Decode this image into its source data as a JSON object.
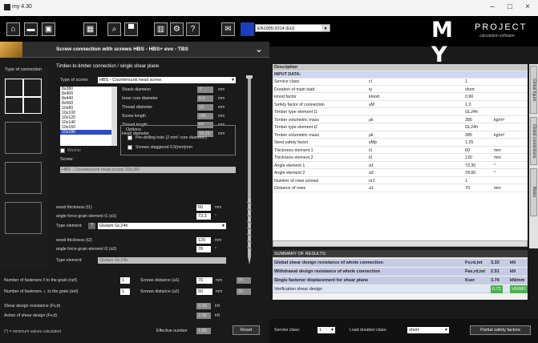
{
  "window": {
    "title": "my 4.30",
    "minimize": "–",
    "maximize": "□",
    "close": "×"
  },
  "toolbar": {
    "standard": "EN1995:2014 (EU)",
    "info": "?"
  },
  "logo": {
    "big": "M Y",
    "brand": "PROJECT",
    "tagline": "calculation software"
  },
  "header": {
    "title": "Screw connection with screws HBS - HBS+ evo - TBS",
    "chevron": "⌄"
  },
  "left": {
    "type_label": "Type of connection"
  },
  "form": {
    "section_title": "Timber-to-timber connection / single shear plane",
    "type_of_screw_label": "Type of screw:",
    "type_of_screw": "HBS - Countersunk head screw",
    "screw_list": [
      "8x380",
      "8x400",
      "8x440",
      "8x500",
      "10x80",
      "10x100",
      "10x120",
      "10x140",
      "10x160",
      "10x180"
    ],
    "screw_selected_index": 9,
    "props": [
      {
        "label": "Shank diameter",
        "value": "7",
        "unit": "mm"
      },
      {
        "label": "Inner core diameter",
        "value": "6.4",
        "unit": "mm"
      },
      {
        "label": "Thread diameter",
        "value": "10",
        "unit": "mm"
      },
      {
        "label": "Screw length",
        "value": "180",
        "unit": "mm"
      },
      {
        "label": "Thread length",
        "value": "60",
        "unit": "mm"
      },
      {
        "label": "Head diameter",
        "value": "18.25",
        "unit": "mm"
      }
    ],
    "options_label": "Options",
    "opt1": "Pre-drilling hole (2 mm² core diameter)",
    "opt2": "Screws staggered 0.5(mm)mm",
    "washer_label": "Washer",
    "screw_label": "Screw:",
    "screw_desc": "HBS - Countersunk head screw 10x180",
    "thickness1_label": "wood thickness (t1)",
    "thickness1": "60",
    "angle1_label": "angle force-grain element t1 (α1)",
    "angle1": "73.3",
    "type_el1_label": "Type element:",
    "type_el1": "Glulam GL24h",
    "thickness2_label": "wood thickness (t2)",
    "thickness2": "120",
    "angle2_label": "angle force-grain element t2 (α2)",
    "angle2": "78",
    "type_el2_label": "Type element:",
    "type_el2": "Glulam GL24h",
    "fast_par_label": "Number of fasteners // to the grain (nef)",
    "fast_par": "1",
    "fast_perp_label": "Number of fasteners ⊥ to the grain (nef)",
    "fast_perp": "1",
    "dist1_label": "Screws distance (a1)",
    "dist1": "70",
    "dist1_min": "70",
    "dist2_label": "Screws distance (a2)",
    "dist2": "50",
    "dist2_min": "50",
    "shear_res_label": "Shear design resistance (Fv,d)",
    "shear_res": "3.33",
    "axial_res_label": "Action of shear design (Fv,d)",
    "axial_res": "2.39",
    "unit_kn": "kN",
    "unit_mm": "mm",
    "unit_deg": "°",
    "note": "(*) = minimum values calculated",
    "effective_label": "Effective number",
    "effective": "1.00",
    "reset": "Reset"
  },
  "table": {
    "headers": [
      "Description",
      "",
      ""
    ],
    "section": "INPUT DATA:",
    "rows": [
      [
        "Service class",
        "cl",
        "1",
        ""
      ],
      [
        "Duration of main load",
        "ty",
        "short",
        ""
      ],
      [
        "kmod factor",
        "kmod",
        "0.90",
        ""
      ],
      [
        "Safety factor of connection",
        "γM",
        "1.3",
        ""
      ],
      [
        "Timber type element t1",
        "",
        "GL24h",
        ""
      ],
      [
        "Timber volumetric mass",
        "ρk",
        "385",
        "kg/m³"
      ],
      [
        "Timber type element t2",
        "",
        "GL24h",
        ""
      ],
      [
        "Timber volumetric mass",
        "ρk",
        "385",
        "kg/m³"
      ],
      [
        "Steel safety factor",
        "γMp",
        "1.25",
        ""
      ],
      [
        "Thickness element 1",
        "t1",
        "60",
        "mm"
      ],
      [
        "Thickness element 2",
        "t2",
        "120",
        "mm"
      ],
      [
        "Angle element 1",
        "α1",
        "73.30",
        "°"
      ],
      [
        "Angle element 2",
        "α2",
        "78.00",
        "°"
      ],
      [
        "Number of rows screws",
        "nr1",
        "1",
        ""
      ],
      [
        "Distance of rows",
        "a1",
        "70",
        "mm"
      ]
    ],
    "summary_title": "SUMMARY OF RESULTS:",
    "summary": [
      [
        "Global shear design resistance of whole connection",
        "Fv,rd,tot",
        "3.33",
        "kN"
      ],
      [
        "Withdrawal design resistance of whole connection",
        "Fax,rd,tot",
        "2.51",
        "kN"
      ],
      [
        "Single fastener displacement for shear plane",
        "Kser",
        "3.74",
        "kN/mm"
      ],
      [
        "Verification shear design",
        "",
        "0.72",
        "VERIFI"
      ]
    ]
  },
  "sidetabs": [
    "Global figure",
    "Global connections",
    "Notes"
  ],
  "bottom": {
    "service_label": "Service class:",
    "service": "1",
    "load_label": "Load duration class:",
    "load": "short",
    "partial": "Partial safety factors"
  },
  "colors": {
    "accent": "#2d4bbf",
    "ok": "#4caf50",
    "header_row": "#3a3a3a"
  }
}
